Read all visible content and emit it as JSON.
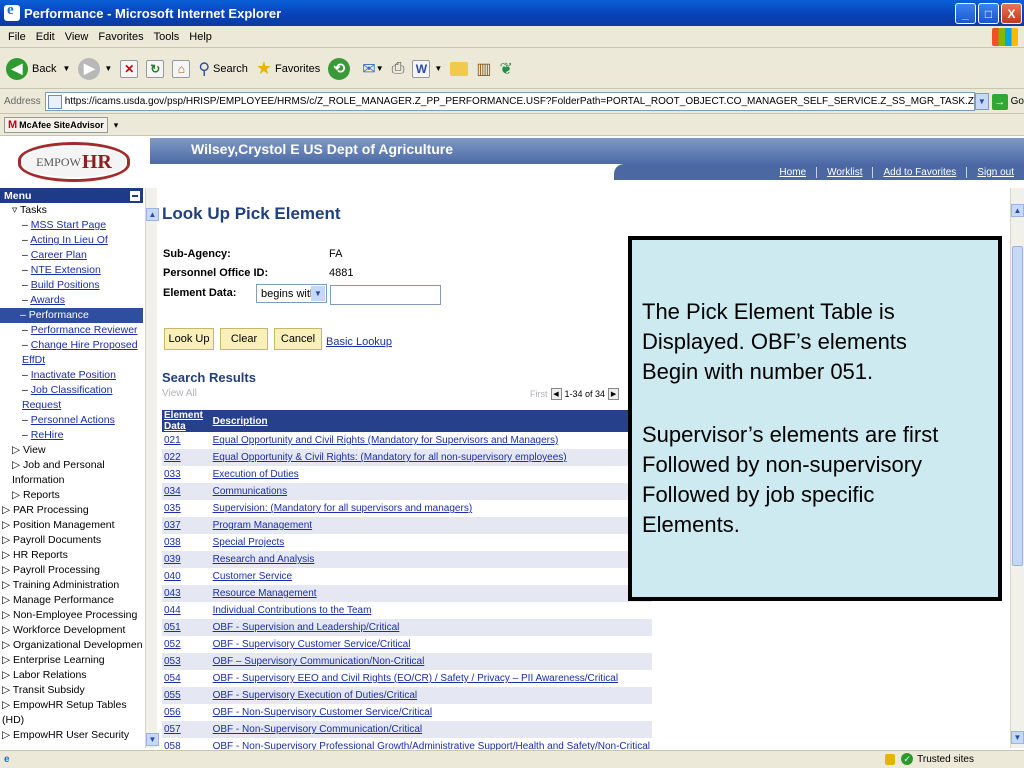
{
  "window": {
    "title": "Performance - Microsoft Internet Explorer",
    "btn_min": "_",
    "btn_max": "□",
    "btn_close": "X"
  },
  "menubar": [
    "File",
    "Edit",
    "View",
    "Favorites",
    "Tools",
    "Help"
  ],
  "toolbar": {
    "back": "Back",
    "search": "Search",
    "favorites": "Favorites"
  },
  "address": {
    "label": "Address",
    "url": "https://icams.usda.gov/psp/HRISP/EMPLOYEE/HRMS/c/Z_ROLE_MANAGER.Z_PP_PERFORMANCE.USF?FolderPath=PORTAL_ROOT_OBJECT.CO_MANAGER_SELF_SERVICE.Z_SS_MGR_TASK.Z_PP_PERFORMANCE_USF_1&IsFolder=false",
    "go": "Go"
  },
  "mcafee": {
    "m": "M",
    "label": "McAfee SiteAdvisor",
    "arrow": "▾"
  },
  "banner": {
    "logo": "EMPOW",
    "logo_bold": "HR",
    "user": "Wilsey,Crystol E  US Dept of Agriculture"
  },
  "nav": [
    "Home",
    "Worklist",
    "Add to Favorites",
    "Sign out"
  ],
  "menu": {
    "title": "Menu",
    "tasks_label": "▿ Tasks",
    "task_links": [
      "MSS Start Page",
      "Acting In Lieu Of",
      "Career Plan",
      "NTE Extension",
      "Build Positions",
      "Awards"
    ],
    "selected": "– Performance",
    "task_links2": [
      "Performance Reviewer",
      "Change Hire Proposed EffDt",
      "Inactivate Position",
      "Job Classification Request",
      "Personnel Actions",
      "ReHire"
    ],
    "sub": [
      "▷ View",
      "▷ Job and Personal Information",
      "▷ Reports"
    ],
    "folders": [
      "▷ PAR Processing",
      "▷ Position Management",
      "▷ Payroll Documents",
      "▷ HR Reports",
      "▷ Payroll Processing",
      "▷ Training Administration",
      "▷ Manage Performance",
      "▷ Non-Employee Processing",
      "▷ Workforce Development",
      "▷ Organizational Development",
      "▷ Enterprise Learning",
      "▷ Labor Relations",
      "▷ Transit Subsidy",
      "▷ EmpowHR Setup Tables (HD)",
      "▷ EmpowHR User Security"
    ]
  },
  "page": {
    "title": "Look Up Pick Element",
    "sub_agency_label": "Sub-Agency:",
    "sub_agency": "FA",
    "poi_label": "Personnel Office ID:",
    "poi": "4881",
    "element_label": "Element Data:",
    "operator": "begins with",
    "element_value": "",
    "lookup": "Look Up",
    "clear": "Clear",
    "cancel": "Cancel",
    "basic": "Basic Lookup",
    "results_title": "Search Results",
    "view_all": "View All",
    "first": "First",
    "range": "1-34 of 34",
    "col_code": "Element Data",
    "col_desc": "Description"
  },
  "rows": [
    {
      "code": "021",
      "desc": "Equal Opportunity and Civil Rights (Mandatory for Supervisors and Managers)"
    },
    {
      "code": "022",
      "desc": "Equal Opportunity & Civil Rights: (Mandatory for all non-supervisory employees)"
    },
    {
      "code": "033",
      "desc": "Execution of Duties"
    },
    {
      "code": "034",
      "desc": "Communications"
    },
    {
      "code": "035",
      "desc": "Supervision: (Mandatory for all supervisors and managers)"
    },
    {
      "code": "037",
      "desc": "Program Management"
    },
    {
      "code": "038",
      "desc": "Special Projects"
    },
    {
      "code": "039",
      "desc": "Research and Analysis"
    },
    {
      "code": "040",
      "desc": "Customer Service"
    },
    {
      "code": "043",
      "desc": "Resource Management"
    },
    {
      "code": "044",
      "desc": "Individual Contributions to the Team"
    },
    {
      "code": "051",
      "desc": "OBF - Supervision and Leadership/Critical"
    },
    {
      "code": "052",
      "desc": "OBF - Supervisory Customer Service/Critical"
    },
    {
      "code": "053",
      "desc": "OBF – Supervisory Communication/Non-Critical"
    },
    {
      "code": "054",
      "desc": "OBF - Supervisory EEO and Civil Rights (EO/CR) / Safety / Privacy – PII Awareness/Critical"
    },
    {
      "code": "055",
      "desc": "OBF - Supervisory Execution of Duties/Critical"
    },
    {
      "code": "056",
      "desc": "OBF - Non-Supervisory Customer Service/Critical"
    },
    {
      "code": "057",
      "desc": "OBF - Non-Supervisory Communication/Critical"
    },
    {
      "code": "058",
      "desc": "OBF - Non-Supervisory Professional Growth/Administrative Support/Health and Safety/Non-Critical"
    }
  ],
  "callout": {
    "p1": [
      "The Pick Element Table is",
      "Displayed.  OBF’s elements",
      "Begin with number 051."
    ],
    "p2": [
      "Supervisor’s elements are first",
      "Followed by non-supervisory",
      "Followed by job specific",
      "Elements."
    ]
  },
  "status": {
    "zone": "Trusted sites"
  },
  "colors": {
    "accent": "#27408b",
    "link": "#1b2ea8",
    "callout_bg": "#cdeaf0"
  }
}
